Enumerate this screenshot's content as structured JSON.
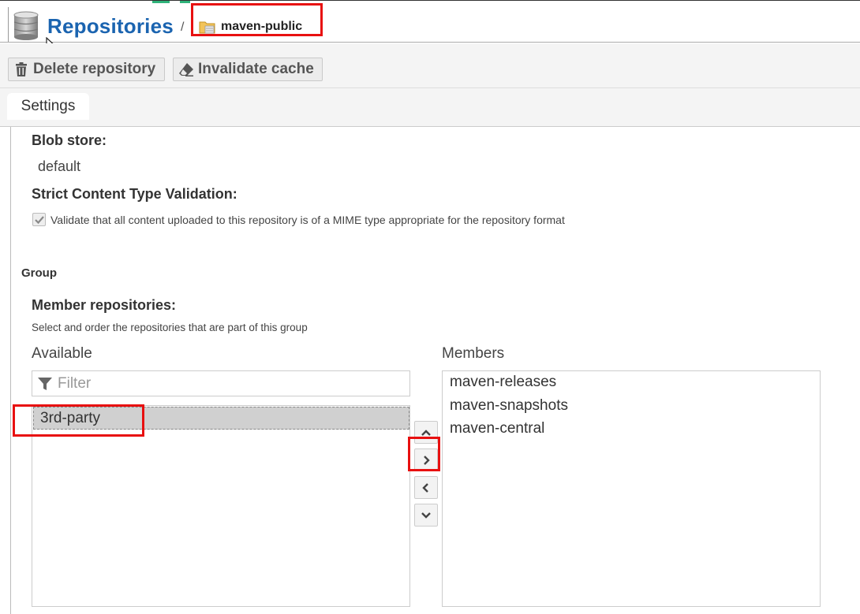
{
  "header": {
    "title": "Repositories",
    "separator": "/",
    "breadcrumb_repo": "maven-public"
  },
  "toolbar": {
    "delete_label": "Delete repository",
    "invalidate_label": "Invalidate cache"
  },
  "tabs": [
    {
      "label": "Settings"
    }
  ],
  "storage": {
    "blob_store_label": "Blob store:",
    "blob_store_value": "default",
    "strict_label": "Strict Content Type Validation:",
    "strict_checked": true,
    "strict_description": "Validate that all content uploaded to this repository is of a MIME type appropriate for the repository format"
  },
  "group": {
    "section_title": "Group",
    "members_label": "Member repositories:",
    "members_help": "Select and order the repositories that are part of this group",
    "available_header": "Available",
    "members_header": "Members",
    "filter_placeholder": "Filter",
    "available": [
      "3rd-party"
    ],
    "members": [
      "maven-releases",
      "maven-snapshots",
      "maven-central"
    ]
  },
  "colors": {
    "title_blue": "#1b64b0",
    "highlight_red": "#e81010"
  },
  "icons": {
    "header": "database-icon",
    "breadcrumb": "folder-icon",
    "delete": "trash-icon",
    "invalidate": "eraser-icon",
    "filter": "filter-icon",
    "move_up": "chevron-up-icon",
    "add": "chevron-right-icon",
    "remove": "chevron-left-icon",
    "move_down": "chevron-down-icon"
  }
}
